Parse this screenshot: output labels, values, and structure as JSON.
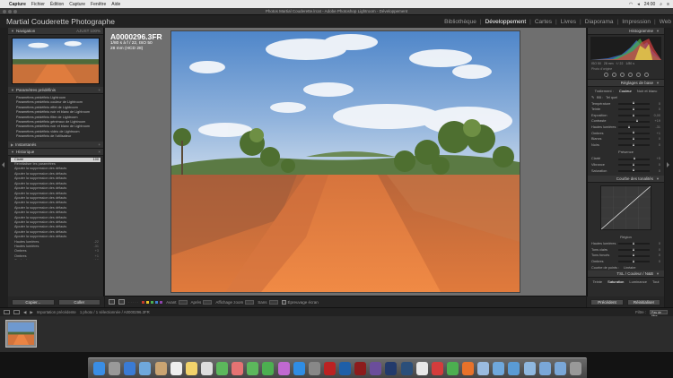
{
  "menubar": {
    "app": "Capture",
    "items": [
      "Fichier",
      "Édition",
      "Capture",
      "Fenêtre",
      "Aide"
    ],
    "clock": "24:00"
  },
  "window": {
    "title": "Photos Martial Couderette.lrcat - Adobe Photoshop Lightroom - Développement"
  },
  "identity_plate": "Martial Couderette Photographe",
  "modules": [
    {
      "label": "Bibliothèque",
      "active": false
    },
    {
      "label": "Développement",
      "active": true
    },
    {
      "label": "Cartes",
      "active": false
    },
    {
      "label": "Livres",
      "active": false
    },
    {
      "label": "Diaporama",
      "active": false
    },
    {
      "label": "Impression",
      "active": false
    },
    {
      "label": "Web",
      "active": false
    }
  ],
  "left": {
    "navigator": {
      "title": "Navigation",
      "tog": "AJUST  100%"
    },
    "presets": {
      "title": "Paramètres prédéfinis",
      "items": [
        "Paramètres prédéfinis Lightroom",
        "Paramètres prédéfinis couleur de Lightroom",
        "Paramètres prédéfinis effet de Lightroom",
        "Paramètres prédéfinis noir et blanc de Lightroom",
        "Paramètres prédéfinis filtre de Lightroom",
        "Paramètres prédéfinis généraux de Lightroom",
        "Paramètres prédéfinis noir et blanc de Lightroom",
        "Paramètres prédéfinis vidéo de Lightroom",
        "Paramètres prédéfinis de l'utilisateur"
      ]
    },
    "snapshots": {
      "title": "Instantanés"
    },
    "history": {
      "title": "Historique",
      "rows": [
        {
          "label": "Clarté",
          "value": "100",
          "sel": true
        },
        {
          "label": "Réinitialiser les paramètres",
          "value": ""
        },
        {
          "label": "Ajouter la suppression des défauts",
          "value": ""
        },
        {
          "label": "Ajouter la suppression des défauts",
          "value": ""
        },
        {
          "label": "Ajouter la suppression des défauts",
          "value": ""
        },
        {
          "label": "Ajouter la suppression des défauts",
          "value": ""
        },
        {
          "label": "Ajouter la suppression des défauts",
          "value": ""
        },
        {
          "label": "Ajouter la suppression des défauts",
          "value": ""
        },
        {
          "label": "Ajouter la suppression des défauts",
          "value": ""
        },
        {
          "label": "Ajouter la suppression des défauts",
          "value": ""
        },
        {
          "label": "Ajouter la suppression des défauts",
          "value": ""
        },
        {
          "label": "Ajouter la suppression des défauts",
          "value": ""
        },
        {
          "label": "Ajouter la suppression des défauts",
          "value": ""
        },
        {
          "label": "Ajouter la suppression des défauts",
          "value": ""
        },
        {
          "label": "Ajouter la suppression des défauts",
          "value": ""
        },
        {
          "label": "Ajouter la suppression des défauts",
          "value": ""
        },
        {
          "label": "Ajouter la suppression des défauts",
          "value": ""
        },
        {
          "label": "Hautes lumières",
          "value": "-22"
        },
        {
          "label": "Hautes lumières",
          "value": "-31"
        },
        {
          "label": "Ombres",
          "value": "+3"
        },
        {
          "label": "Ombres",
          "value": "+1"
        },
        {
          "label": "Contraste",
          "value": "+19"
        },
        {
          "label": "Contraste",
          "value": "+11"
        },
        {
          "label": "Clarté",
          "value": "+5"
        }
      ]
    },
    "buttons": {
      "copy": "Copier...",
      "paste": "Coller"
    }
  },
  "center": {
    "filename": "A0000296.3FR",
    "exif1": "1/80 s à f / 22, ISO 50",
    "exif2": "28 mm (HCD 28)",
    "toolbar": {
      "view_label": "Avant",
      "after_label": "Après",
      "zoom_label": "Affichage zoom",
      "slideshow_label": "Sans",
      "soft_proof": "Épreuvage écran",
      "stars": "· · · · ·",
      "colors": [
        "#c0392b",
        "#e6c229",
        "#4caf50",
        "#3f7fd0",
        "#8e44ad"
      ]
    }
  },
  "right": {
    "histogram": {
      "title": "Histogramme",
      "info": [
        "ISO 50",
        "28 mm",
        "f / 22",
        "1/80 s"
      ],
      "orig": "Photo d'origine"
    },
    "basic": {
      "title": "Réglages de base",
      "treatment_label": "Traitement :",
      "treatment": [
        "Couleur",
        "Noir et blanc"
      ],
      "wb_label": "BB :",
      "wb_value": "Tel quel",
      "tone_label": "Tonalités",
      "auto": "Auto",
      "sliders": [
        {
          "label": "Température",
          "value": "0",
          "pos": 0.5
        },
        {
          "label": "Teinte",
          "value": "0",
          "pos": 0.5
        },
        {
          "label": "Exposition",
          "value": "0,00",
          "pos": 0.5
        },
        {
          "label": "Contraste",
          "value": "+19",
          "pos": 0.6
        },
        {
          "label": "Hautes lumières",
          "value": "-31",
          "pos": 0.35
        },
        {
          "label": "Ombres",
          "value": "+1",
          "pos": 0.5
        },
        {
          "label": "Blancs",
          "value": "0",
          "pos": 0.5
        },
        {
          "label": "Noirs",
          "value": "0",
          "pos": 0.5
        }
      ],
      "presence_label": "Présence",
      "presence": [
        {
          "label": "Clarté",
          "value": "+5",
          "pos": 0.53
        },
        {
          "label": "Vibrance",
          "value": "0",
          "pos": 0.5
        },
        {
          "label": "Saturation",
          "value": "0",
          "pos": 0.5
        }
      ]
    },
    "tone_curve": {
      "title": "Courbe des tonalités",
      "region_label": "Région",
      "sliders": [
        {
          "label": "Hautes lumières",
          "value": "0",
          "pos": 0.5
        },
        {
          "label": "Tons clairs",
          "value": "0",
          "pos": 0.5
        },
        {
          "label": "Tons foncés",
          "value": "0",
          "pos": 0.5
        },
        {
          "label": "Ombres",
          "value": "0",
          "pos": 0.5
        }
      ],
      "curve_label": "Courbe de points :",
      "curve_value": "Linéaire"
    },
    "hsl": {
      "title": "TSL / Couleur / N&B",
      "tabs": [
        "Teinte",
        "Saturation",
        "Luminance",
        "Tout"
      ]
    },
    "buttons": {
      "previous": "Précédent",
      "reset": "Réinitialiser"
    }
  },
  "filmbar": {
    "source": "Importation précédente",
    "count": "1 photo / 1 sélectionnée / A0000296.3FR",
    "filter_label": "Filtre :",
    "filter_value": "Pas de filtre"
  },
  "dock": [
    "Finder",
    "Launchpad",
    "Safari",
    "Mail",
    "Contacts",
    "Calendrier",
    "Notes",
    "Rappels",
    "Plans",
    "Photos",
    "Messages",
    "FaceTime",
    "iTunes",
    "App Store",
    "Préférences",
    "FileZilla",
    "Ps",
    "FP",
    "Bridge",
    "VP",
    "Lr",
    "iCal",
    "Opera",
    "Chrome",
    "Firefox",
    "Aperçu",
    "Dossier",
    "Téléchargements",
    "Documents",
    "Applications",
    "Images",
    "Corbeille"
  ]
}
